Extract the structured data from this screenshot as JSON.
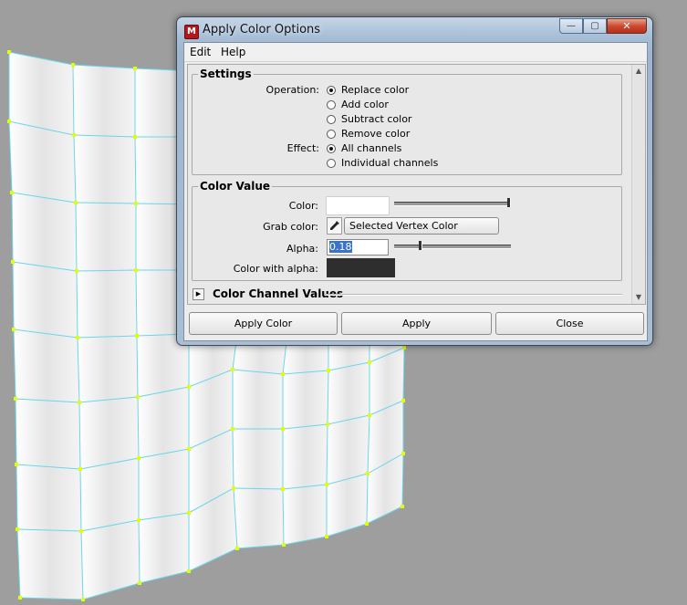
{
  "dialog": {
    "title": "Apply Color Options",
    "app_icon_glyph": "M",
    "minimize_glyph": "—",
    "maximize_glyph": "▢",
    "close_glyph": "✕"
  },
  "menubar": {
    "items": [
      "Edit",
      "Help"
    ]
  },
  "settings": {
    "title": "Settings",
    "operation_label": "Operation:",
    "operation_options": [
      {
        "label": "Replace color",
        "selected": true
      },
      {
        "label": "Add color",
        "selected": false
      },
      {
        "label": "Subtract color",
        "selected": false
      },
      {
        "label": "Remove color",
        "selected": false
      }
    ],
    "effect_label": "Effect:",
    "effect_options": [
      {
        "label": "All channels",
        "selected": true
      },
      {
        "label": "Individual channels",
        "selected": false
      }
    ]
  },
  "color_value": {
    "title": "Color Value",
    "color_label": "Color:",
    "color_hex": "#ffffff",
    "color_slider_fraction": 1.0,
    "grab_label": "Grab color:",
    "grab_button_label": "Selected Vertex Color",
    "alpha_label": "Alpha:",
    "alpha_value": "0.18",
    "alpha_slider_fraction": 0.18,
    "color_with_alpha_label": "Color with alpha:",
    "color_with_alpha_hex": "#2e2e2e"
  },
  "channel_values": {
    "title": "Color Channel Values",
    "expanded": false
  },
  "buttons": {
    "apply_color": "Apply Color",
    "apply": "Apply",
    "close": "Close"
  },
  "icons": [
    "eyedropper-icon",
    "expand-arrow-icon",
    "scroll-up-arrow-icon",
    "scroll-down-arrow-icon"
  ],
  "colors": {
    "viewport_bg": "#9e9e9e",
    "wire": "#6ad6e8",
    "vertex": "#e5ff00",
    "selection": "#3a73c7"
  }
}
